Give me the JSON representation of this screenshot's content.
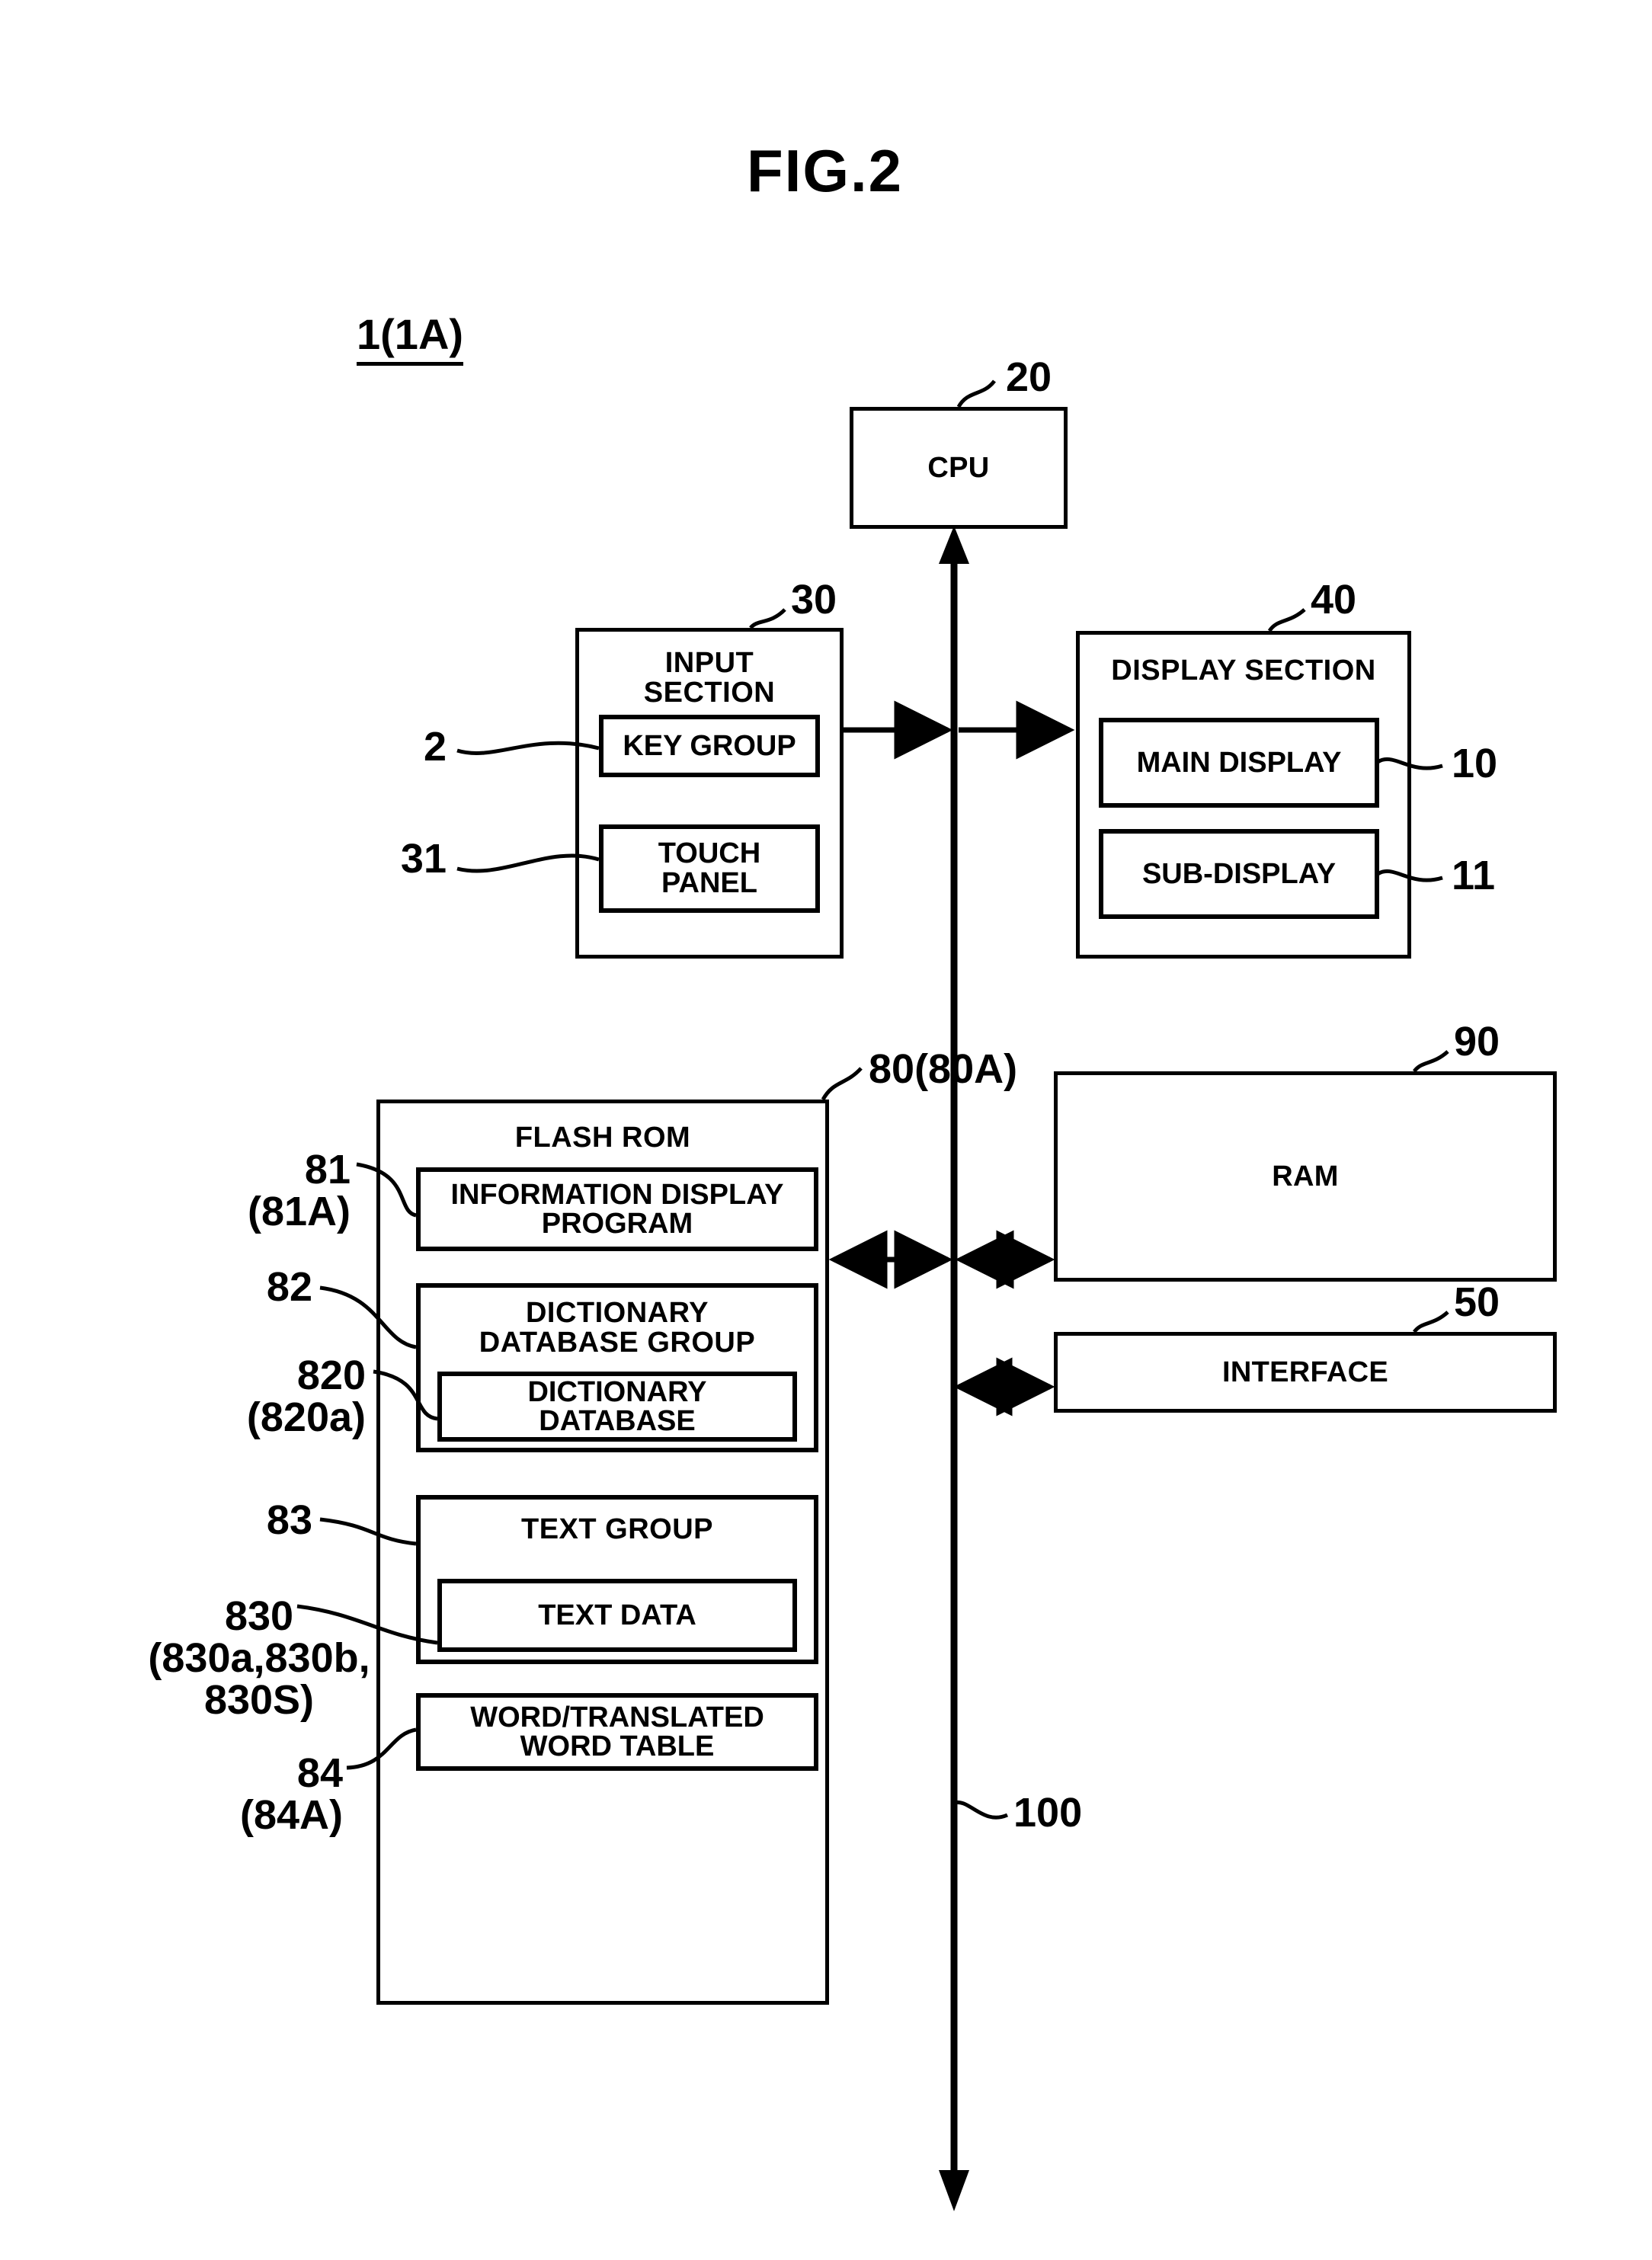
{
  "figure": {
    "title": "FIG.2",
    "device_label": "1(1A)"
  },
  "blocks": {
    "cpu": {
      "label": "CPU",
      "ref": "20"
    },
    "input_section": {
      "label": "INPUT\nSECTION",
      "ref": "30",
      "children": [
        {
          "label": "KEY GROUP",
          "ref": "2"
        },
        {
          "label": "TOUCH\nPANEL",
          "ref": "31"
        }
      ]
    },
    "display_section": {
      "label": "DISPLAY SECTION",
      "ref": "40",
      "children": [
        {
          "label": "MAIN DISPLAY",
          "ref": "10"
        },
        {
          "label": "SUB-DISPLAY",
          "ref": "11"
        }
      ]
    },
    "flash_rom": {
      "label": "FLASH ROM",
      "ref": "80(80A)",
      "children": [
        {
          "label": "INFORMATION DISPLAY\nPROGRAM",
          "ref": "81\n(81A)"
        },
        {
          "label": "DICTIONARY\nDATABASE GROUP",
          "ref": "82",
          "children": [
            {
              "label": "DICTIONARY\nDATABASE",
              "ref": "820\n(820a)"
            }
          ]
        },
        {
          "label": "TEXT GROUP",
          "ref": "83",
          "children": [
            {
              "label": "TEXT DATA",
              "ref": "830\n(830a,830b,\n830S)"
            }
          ]
        },
        {
          "label": "WORD/TRANSLATED\nWORD TABLE",
          "ref": "84\n(84A)"
        }
      ]
    },
    "ram": {
      "label": "RAM",
      "ref": "90"
    },
    "interface": {
      "label": "INTERFACE",
      "ref": "50"
    },
    "bus": {
      "ref": "100"
    }
  },
  "colors": {
    "line": "#000000",
    "background": "#ffffff"
  }
}
